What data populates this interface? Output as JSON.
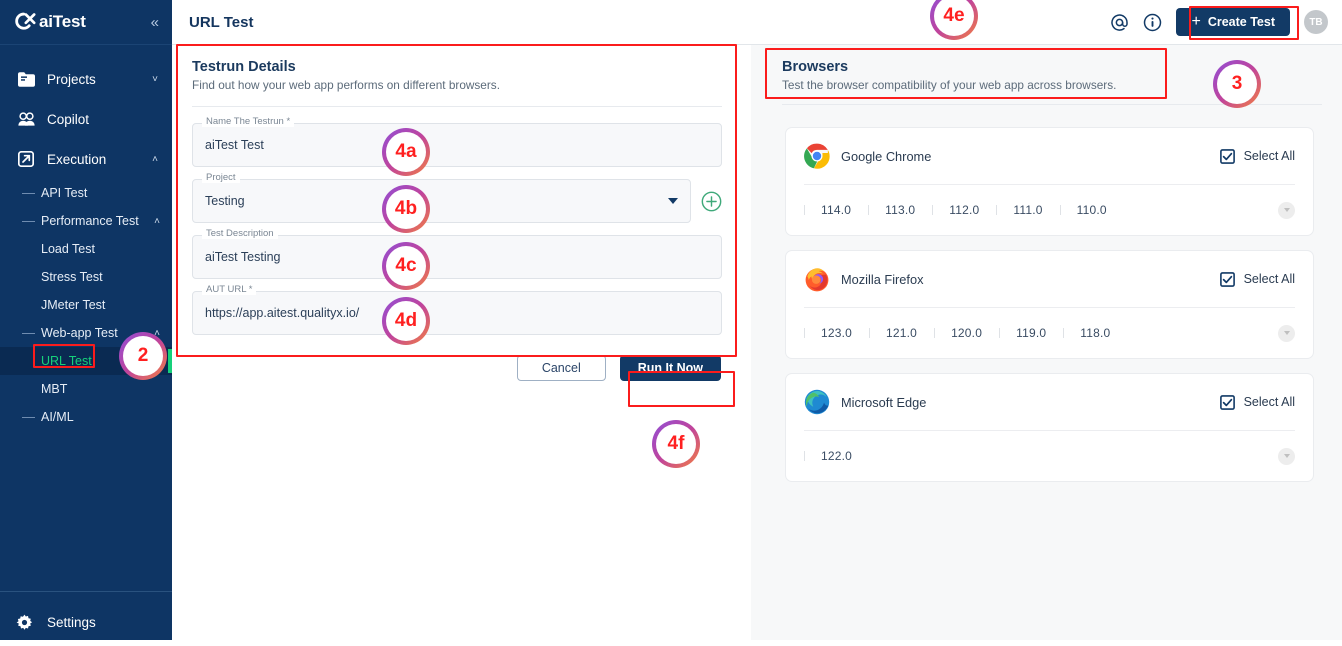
{
  "brand": {
    "logo_text": "aiTest",
    "collapse_icon": "chevrons-left-icon"
  },
  "sidebar": {
    "items": [
      {
        "label": "Projects",
        "icon": "folder-icon",
        "chevron": "˅"
      },
      {
        "label": "Copilot",
        "icon": "copilot-icon",
        "chevron": ""
      },
      {
        "label": "Execution",
        "icon": "external-link-icon",
        "chevron": "˄"
      }
    ],
    "sub_items": [
      {
        "label": "API Test",
        "dash": true,
        "chevron": "",
        "active": false
      },
      {
        "label": "Performance Test",
        "dash": true,
        "chevron": "˄",
        "active": false
      },
      {
        "label": "Load Test",
        "dash": false,
        "chevron": "",
        "active": false
      },
      {
        "label": "Stress Test",
        "dash": false,
        "chevron": "",
        "active": false
      },
      {
        "label": "JMeter Test",
        "dash": false,
        "chevron": "",
        "active": false
      },
      {
        "label": "Web-app Test",
        "dash": true,
        "chevron": "˄",
        "active": false
      },
      {
        "label": "URL Test",
        "dash": false,
        "chevron": "",
        "active": true
      },
      {
        "label": "MBT",
        "dash": false,
        "chevron": "",
        "active": false
      },
      {
        "label": "AI/ML",
        "dash": true,
        "chevron": "",
        "active": false
      }
    ],
    "settings_label": "Settings",
    "settings_icon": "gear-icon",
    "active_accent": "#16d07a"
  },
  "header": {
    "title": "URL Test",
    "mention_icon": "at-sign-icon",
    "info_icon": "info-circle-icon",
    "create_label": "Create Test",
    "create_plus": "+",
    "avatar_initials": "TB",
    "accent": "#123a66"
  },
  "testrun": {
    "title": "Testrun Details",
    "subtitle": "Find out how your web app performs on different browsers.",
    "fields": [
      {
        "label": "Name The Testrun *",
        "value": "aiTest Test"
      },
      {
        "label": "Project",
        "value": "Testing"
      },
      {
        "label": "Test Description",
        "value": "aiTest Testing"
      },
      {
        "label": "AUT URL *",
        "value": "https://app.aitest.qualityx.io/"
      }
    ],
    "add_project_icon": "plus-circle-icon",
    "dropdown_icon": "caret-down-icon",
    "cancel_label": "Cancel",
    "run_label": "Run It Now"
  },
  "browsers": {
    "title": "Browsers",
    "subtitle": "Test the browser compatibility of your web app across browsers.",
    "select_all_label": "Select All",
    "more_icon": "chevron-down-circle-icon",
    "cards": [
      {
        "name": "Google Chrome",
        "icon": "chrome-icon",
        "select_all": true,
        "versions": [
          "114.0",
          "113.0",
          "112.0",
          "111.0",
          "110.0"
        ]
      },
      {
        "name": "Mozilla Firefox",
        "icon": "firefox-icon",
        "select_all": true,
        "versions": [
          "123.0",
          "121.0",
          "120.0",
          "119.0",
          "118.0"
        ]
      },
      {
        "name": "Microsoft Edge",
        "icon": "edge-icon",
        "select_all": true,
        "versions": [
          "122.0"
        ]
      }
    ]
  },
  "annotations": {
    "color": "#ff2020",
    "badges": [
      {
        "id": "4a",
        "label": "4a"
      },
      {
        "id": "4b",
        "label": "4b"
      },
      {
        "id": "4c",
        "label": "4c"
      },
      {
        "id": "4d",
        "label": "4d"
      },
      {
        "id": "4e",
        "label": "4e"
      },
      {
        "id": "4f",
        "label": "4f"
      },
      {
        "id": "2",
        "label": "2"
      },
      {
        "id": "3",
        "label": "3"
      }
    ]
  }
}
